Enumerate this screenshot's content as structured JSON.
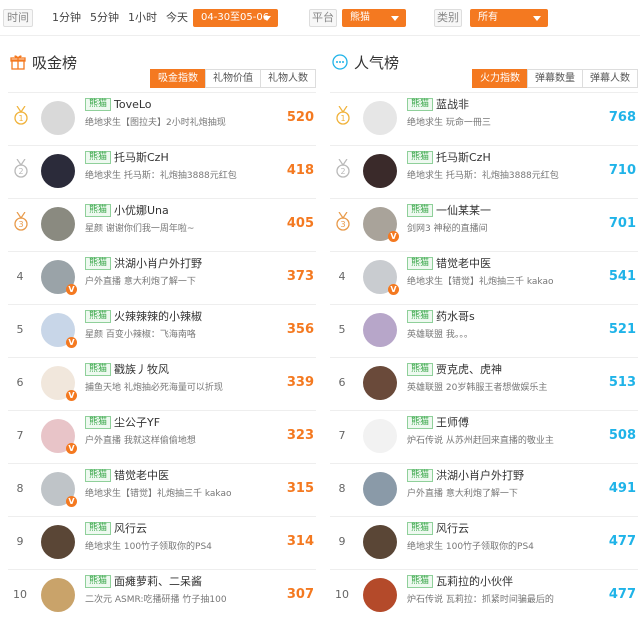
{
  "filters": {
    "time_label": "时间",
    "time_options": [
      "1分钟",
      "5分钟",
      "1小时",
      "今天"
    ],
    "date_range": "04-30至05-06",
    "platform_label": "平台",
    "platform_value": "熊猫",
    "category_label": "类别",
    "category_value": "所有"
  },
  "left": {
    "title": "吸金榜",
    "icon": "gift-icon",
    "accent": "#f47920",
    "tabs": [
      "吸金指数",
      "礼物价值",
      "礼物人数"
    ],
    "active_tab": 0,
    "rows": [
      {
        "rank": "1",
        "badge": "熊猫",
        "name": "ToveLo",
        "desc": "绝地求生【图拉夫】2小时礼炮抽现",
        "score": "520"
      },
      {
        "rank": "2",
        "badge": "熊猫",
        "name": "托马斯CzH",
        "desc": "绝地求生 托马斯：礼炮抽3888元红包",
        "score": "418"
      },
      {
        "rank": "3",
        "badge": "熊猫",
        "name": "小优娜Una",
        "desc": "星颜 谢谢你们我一周年啦~",
        "score": "405"
      },
      {
        "rank": "4",
        "badge": "熊猫",
        "name": "洪湖小肖户外打野",
        "desc": "户外直播 意大利炮了解一下",
        "score": "373"
      },
      {
        "rank": "5",
        "badge": "熊猫",
        "name": "火辣辣辣的小辣椒",
        "desc": "星颜 百变小辣椒：飞海南咯",
        "score": "356"
      },
      {
        "rank": "6",
        "badge": "熊猫",
        "name": "戳族丿牧风",
        "desc": "捕鱼天地 礼炮抽必死海量可以折现",
        "score": "339"
      },
      {
        "rank": "7",
        "badge": "熊猫",
        "name": "尘公子YF",
        "desc": "户外直播 我就这样偷偷地想",
        "score": "323"
      },
      {
        "rank": "8",
        "badge": "熊猫",
        "name": "错觉老中医",
        "desc": "绝地求生【错觉】礼炮抽三千 kakao",
        "score": "315"
      },
      {
        "rank": "9",
        "badge": "熊猫",
        "name": "风行云",
        "desc": "绝地求生 100竹子领取你的PS4",
        "score": "314"
      },
      {
        "rank": "10",
        "badge": "熊猫",
        "name": "面瘫萝莉、二呆酱",
        "desc": "二次元 ASMR:吃播研播 竹子抽100",
        "score": "307"
      }
    ]
  },
  "right": {
    "title": "人气榜",
    "icon": "chat-icon",
    "accent": "#1fb3e8",
    "tabs": [
      "火力指数",
      "弹幕数量",
      "弹幕人数"
    ],
    "active_tab": 0,
    "rows": [
      {
        "rank": "1",
        "badge": "熊猫",
        "name": "蓝战非",
        "desc": "绝地求生 玩命一冊三",
        "score": "768"
      },
      {
        "rank": "2",
        "badge": "熊猫",
        "name": "托马斯CzH",
        "desc": "绝地求生 托马斯：礼炮抽3888元红包",
        "score": "710"
      },
      {
        "rank": "3",
        "badge": "熊猫",
        "name": "一仙某某一",
        "desc": "剑网3 神秘的直播间",
        "score": "701"
      },
      {
        "rank": "4",
        "badge": "熊猫",
        "name": "错觉老中医",
        "desc": "绝地求生【错觉】礼炮抽三千 kakao",
        "score": "541"
      },
      {
        "rank": "5",
        "badge": "熊猫",
        "name": "药水哥s",
        "desc": "英雄联盟 我。。。",
        "score": "521"
      },
      {
        "rank": "6",
        "badge": "熊猫",
        "name": "贾克虎、虎神",
        "desc": "英雄联盟 20岁韩服王者想做娱乐主",
        "score": "513"
      },
      {
        "rank": "7",
        "badge": "熊猫",
        "name": "王师傅",
        "desc": "炉石传说 从苏州赶回来直播的敬业主",
        "score": "508"
      },
      {
        "rank": "8",
        "badge": "熊猫",
        "name": "洪湖小肖户外打野",
        "desc": "户外直播 意大利炮了解一下",
        "score": "491"
      },
      {
        "rank": "9",
        "badge": "熊猫",
        "name": "风行云",
        "desc": "绝地求生 100竹子领取你的PS4",
        "score": "477"
      },
      {
        "rank": "10",
        "badge": "熊猫",
        "name": "瓦莉拉的小伙伴",
        "desc": "炉石传说 瓦莉拉：抓紧时间骗最后的",
        "score": "477"
      }
    ]
  }
}
